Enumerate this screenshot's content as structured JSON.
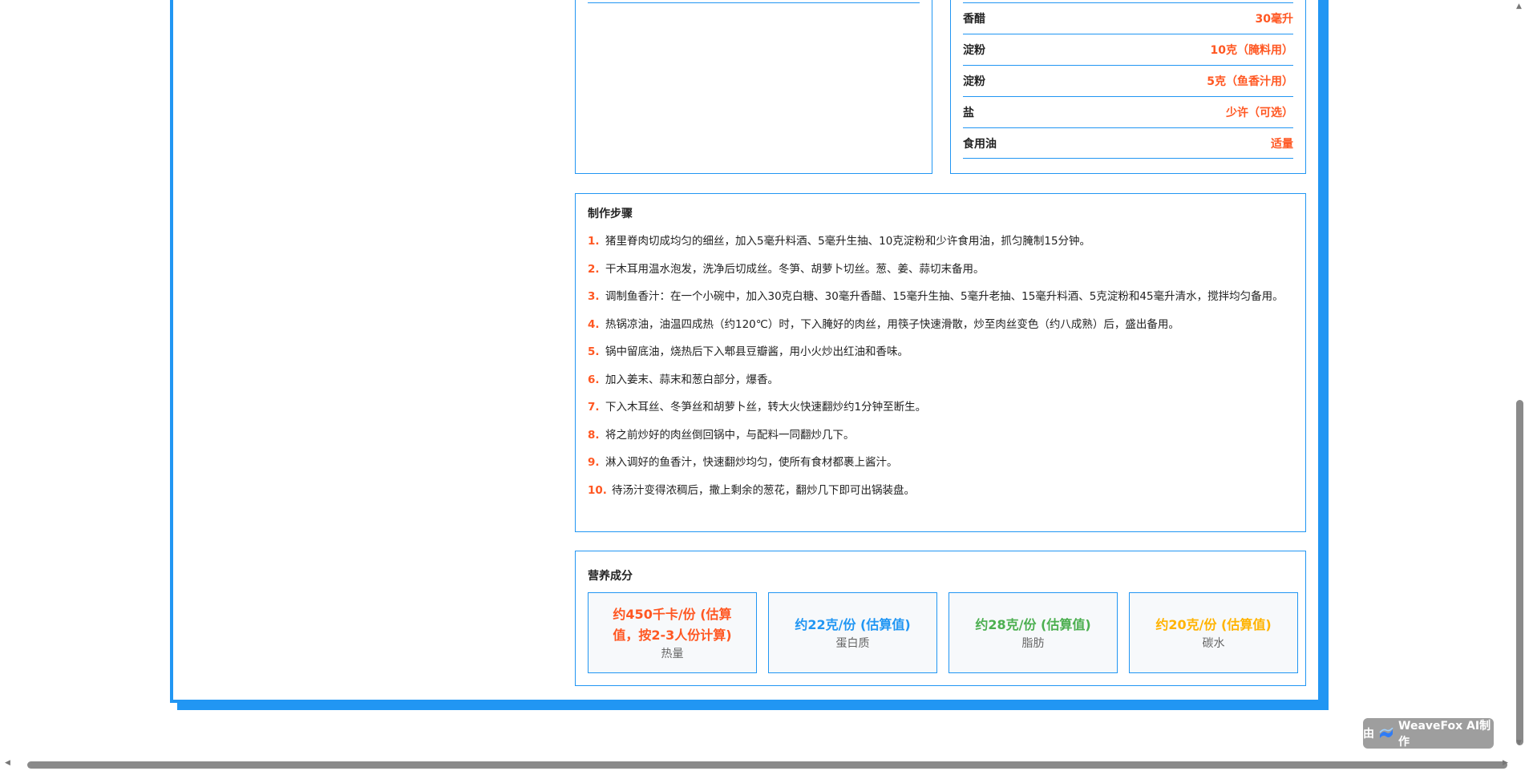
{
  "ingredients_right": [
    {
      "name": "香醋",
      "amount": "30毫升"
    },
    {
      "name": "淀粉",
      "amount": "10克（腌料用）"
    },
    {
      "name": "淀粉",
      "amount": "5克（鱼香汁用）"
    },
    {
      "name": "盐",
      "amount": "少许（可选）"
    },
    {
      "name": "食用油",
      "amount": "适量"
    }
  ],
  "steps": {
    "title": "制作步骤",
    "items": [
      {
        "num": "1.",
        "text": "猪里脊肉切成均匀的细丝，加入5毫升料酒、5毫升生抽、10克淀粉和少许食用油，抓匀腌制15分钟。"
      },
      {
        "num": "2.",
        "text": "干木耳用温水泡发，洗净后切成丝。冬笋、胡萝卜切丝。葱、姜、蒜切末备用。"
      },
      {
        "num": "3.",
        "text": "调制鱼香汁：在一个小碗中，加入30克白糖、30毫升香醋、15毫升生抽、5毫升老抽、15毫升料酒、5克淀粉和45毫升清水，搅拌均匀备用。"
      },
      {
        "num": "4.",
        "text": "热锅凉油，油温四成热（约120℃）时，下入腌好的肉丝，用筷子快速滑散，炒至肉丝变色（约八成熟）后，盛出备用。"
      },
      {
        "num": "5.",
        "text": "锅中留底油，烧热后下入郫县豆瓣酱，用小火炒出红油和香味。"
      },
      {
        "num": "6.",
        "text": "加入姜末、蒜末和葱白部分，爆香。"
      },
      {
        "num": "7.",
        "text": "下入木耳丝、冬笋丝和胡萝卜丝，转大火快速翻炒约1分钟至断生。"
      },
      {
        "num": "8.",
        "text": "将之前炒好的肉丝倒回锅中，与配料一同翻炒几下。"
      },
      {
        "num": "9.",
        "text": "淋入调好的鱼香汁，快速翻炒均匀，使所有食材都裹上酱汁。"
      },
      {
        "num": "10.",
        "text": "待汤汁变得浓稠后，撒上剩余的葱花，翻炒几下即可出锅装盘。"
      }
    ]
  },
  "nutrition": {
    "title": "营养成分",
    "items": [
      {
        "value": "约450千卡/份 (估算值，按2-3人份计算)",
        "label": "热量",
        "color": "#ff5722"
      },
      {
        "value": "约22克/份 (估算值)",
        "label": "蛋白质",
        "color": "#2196f3"
      },
      {
        "value": "约28克/份 (估算值)",
        "label": "脂肪",
        "color": "#4caf50"
      },
      {
        "value": "约20克/份 (估算值)",
        "label": "碳水",
        "color": "#ffb300"
      }
    ]
  },
  "badge": {
    "prefix": "由",
    "brand": "WeaveFox AI制作",
    "icon": "weavefox-logo-icon"
  }
}
